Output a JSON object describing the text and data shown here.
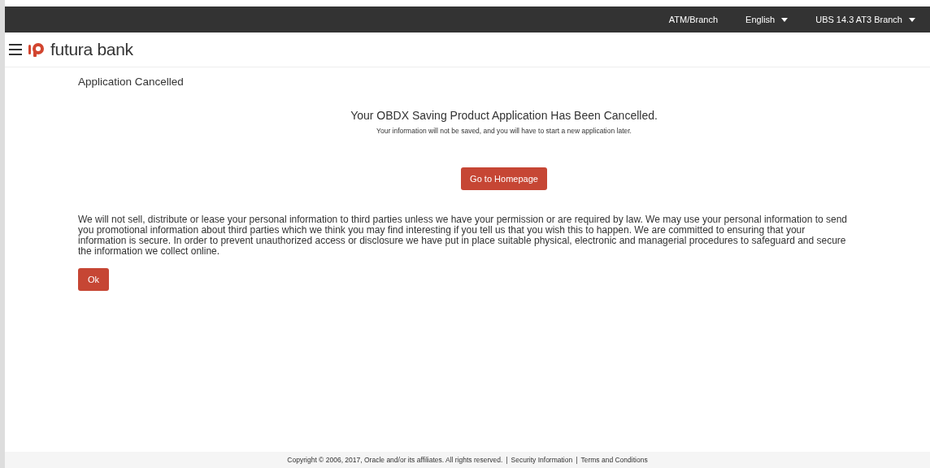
{
  "topbar": {
    "items": [
      {
        "label": "ATM/Branch",
        "dropdown": false
      },
      {
        "label": "English",
        "dropdown": true
      },
      {
        "label": "UBS 14.3 AT3 Branch",
        "dropdown": true
      }
    ]
  },
  "header": {
    "brand": "futura bank"
  },
  "page_title": "Application Cancelled",
  "message": {
    "heading": "Your OBDX Saving Product Application Has Been Cancelled.",
    "subtext": "Your information will not be saved, and you will have to start a new application later.",
    "button": "Go to Homepage"
  },
  "privacy_text": "We will not sell, distribute or lease your personal information to third parties unless we have your permission or are required by law. We may use your personal information to send you promotional information about third parties which we think you may find interesting if you tell us that you wish this to happen. We are committed to ensuring that your information is secure. In order to prevent unauthorized access or disclosure we have put in place suitable physical, electronic and managerial procedures to safeguard and secure the information we collect online.",
  "ok_button": "Ok",
  "footer": {
    "copyright": "Copyright © 2006, 2017, Oracle and/or its affiliates. All rights reserved.",
    "separators": [
      "|",
      "|"
    ],
    "links": [
      "Security Information",
      "Terms and Conditions"
    ]
  }
}
